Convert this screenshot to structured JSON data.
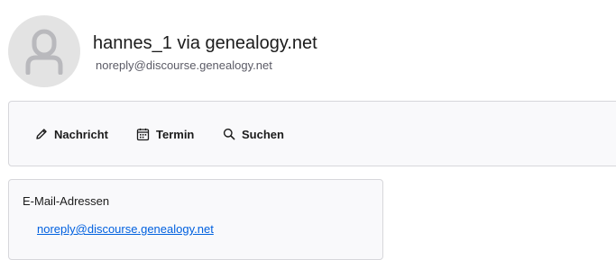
{
  "contact": {
    "name": "hannes_1 via genealogy.net",
    "email": "noreply@discourse.genealogy.net",
    "avatar_icon": "person-silhouette-icon"
  },
  "toolbar": {
    "buttons": [
      {
        "label": "Nachricht",
        "icon": "pencil-icon"
      },
      {
        "label": "Termin",
        "icon": "calendar-icon"
      },
      {
        "label": "Suchen",
        "icon": "search-icon"
      }
    ]
  },
  "email_card": {
    "title": "E-Mail-Adressen",
    "addresses": [
      "noreply@discourse.genealogy.net"
    ]
  },
  "colors": {
    "link": "#0060df",
    "panel_bg": "#f9f9fb",
    "border": "#d7d7db",
    "avatar_bg": "#e3e3e3",
    "avatar_fg": "#b9b9bd"
  }
}
